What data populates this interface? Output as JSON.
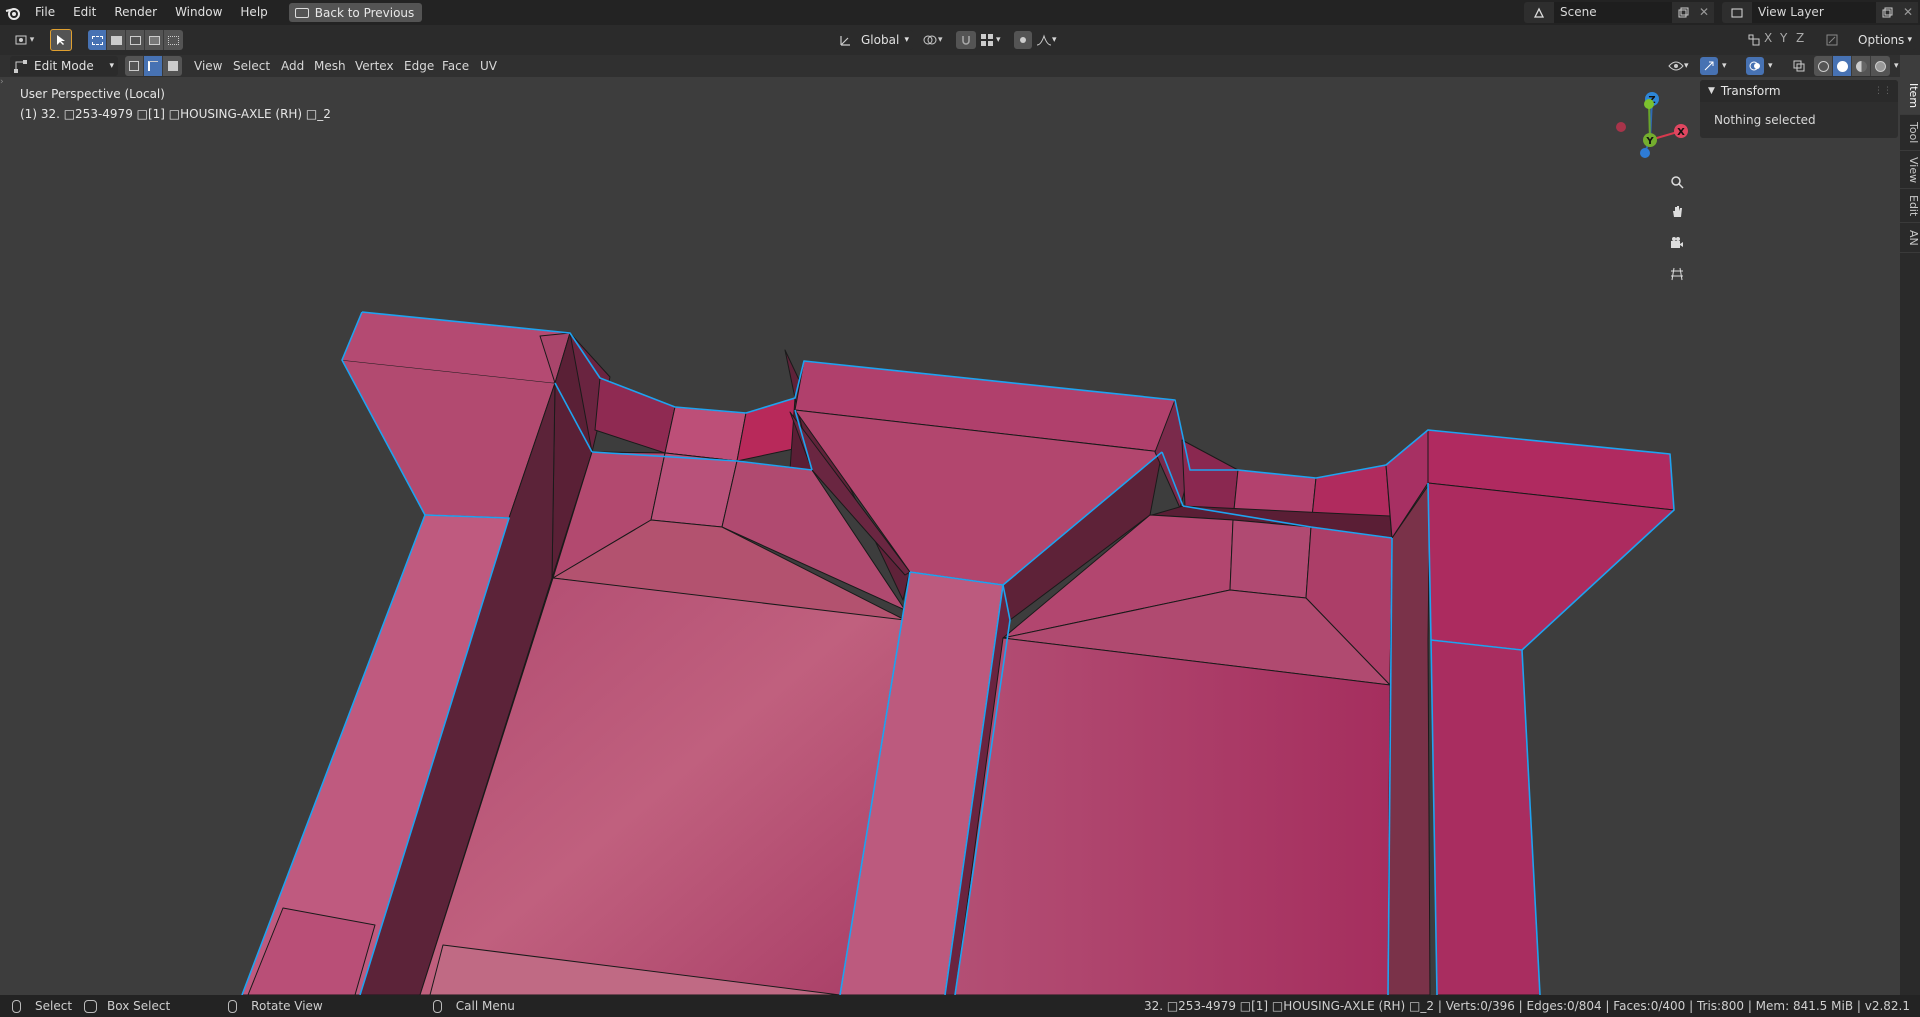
{
  "topbar": {
    "menus": [
      "File",
      "Edit",
      "Render",
      "Window",
      "Help"
    ],
    "back_button": "Back to Previous",
    "scene_label": "Scene",
    "view_layer_label": "View Layer"
  },
  "header": {
    "orientation": "Global",
    "options_label": "Options"
  },
  "edit_header": {
    "mode": "Edit Mode",
    "menus": [
      "View",
      "Select",
      "Add",
      "Mesh",
      "Vertex",
      "Edge",
      "Face",
      "UV"
    ]
  },
  "viewport": {
    "perspective": "User Perspective (Local)",
    "object_info": "(1) 32. □253-4979 □[1] □HOUSING-AXLE (RH) □_2",
    "gizmo": {
      "x": "X",
      "y": "Y",
      "z": "Z"
    }
  },
  "sidebar": {
    "panel_title": "Transform",
    "nothing_selected": "Nothing selected",
    "tabs": [
      "Item",
      "Tool",
      "View",
      "Edit",
      "AN"
    ]
  },
  "statusbar": {
    "select": "Select",
    "box_select": "Box Select",
    "rotate_view": "Rotate View",
    "call_menu": "Call Menu",
    "stats": "32. □253-4979 □[1] □HOUSING-AXLE (RH) □_2 | Verts:0/396 | Edges:0/804 | Faces:0/400 | Tris:800 | Mem: 841.5 MiB | v2.82.1"
  },
  "colors": {
    "mesh_face": "#b04a70",
    "mesh_edge": "#1fa3f0",
    "accent": "#4772b3"
  }
}
